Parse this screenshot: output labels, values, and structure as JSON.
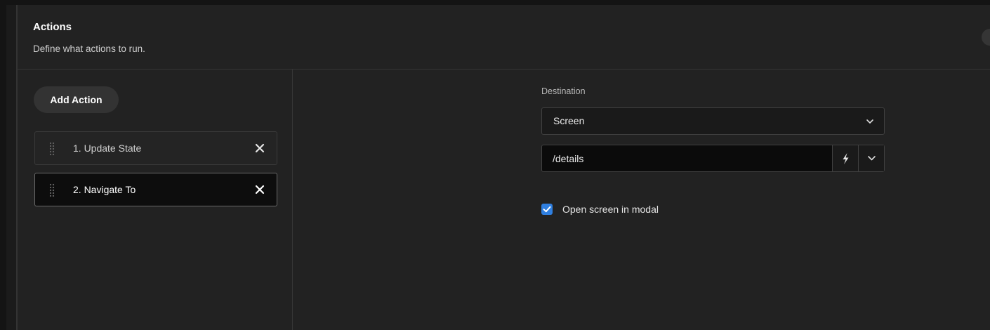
{
  "header": {
    "title": "Actions",
    "subtitle": "Define what actions to run."
  },
  "sidebar": {
    "add_button_label": "Add Action",
    "actions": [
      {
        "label": "1. Update State",
        "selected": false
      },
      {
        "label": "2. Navigate To",
        "selected": true
      }
    ]
  },
  "config": {
    "destination_label": "Destination",
    "destination_value": "Screen",
    "path_value": "/details",
    "modal_checkbox_label": "Open screen in modal",
    "modal_checked": true
  },
  "icons": {
    "remove": "close-icon",
    "drag": "drag-handle-icon",
    "dropdown": "chevron-down-icon",
    "bindings": "lightning-bolt-icon",
    "check": "checkmark-icon"
  },
  "colors": {
    "accent": "#2f7fe0",
    "panel_bg": "#222222",
    "selected_item_bg": "#0d0d0d"
  }
}
